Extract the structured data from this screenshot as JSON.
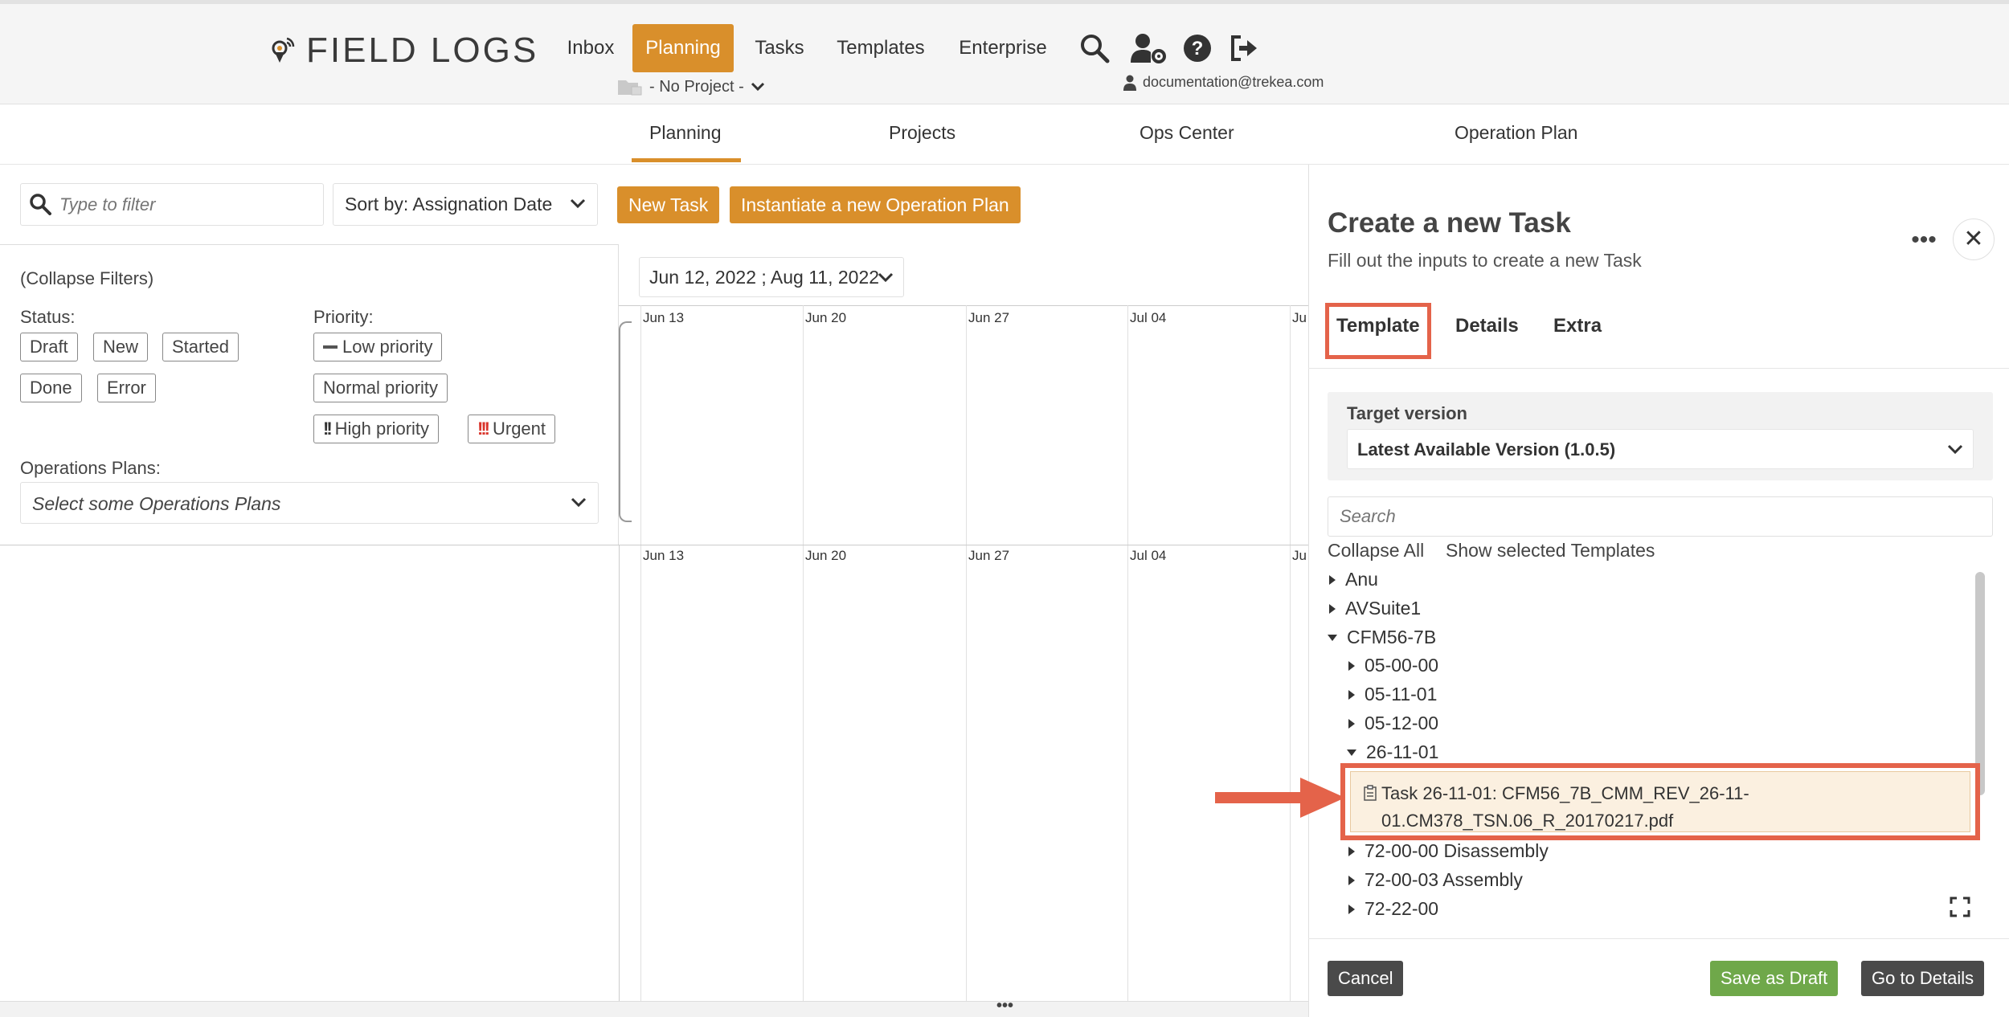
{
  "brand": {
    "name": "FIELD LOGS"
  },
  "topnav": {
    "items": [
      {
        "label": "Inbox"
      },
      {
        "label": "Planning"
      },
      {
        "label": "Tasks"
      },
      {
        "label": "Templates"
      },
      {
        "label": "Enterprise"
      }
    ],
    "project": "- No Project -",
    "user_email": "documentation@trekea.com"
  },
  "subnav": {
    "tabs": [
      {
        "label": "Planning"
      },
      {
        "label": "Projects"
      },
      {
        "label": "Ops Center"
      },
      {
        "label": "Operation Plan"
      }
    ]
  },
  "toolbar": {
    "filter_placeholder": "Type to filter",
    "sort_label": "Sort by: Assignation Date",
    "new_task": "New Task",
    "instantiate": "Instantiate a new Operation Plan"
  },
  "filters": {
    "collapse": "(Collapse Filters)",
    "status_label": "Status:",
    "status": [
      "Draft",
      "New",
      "Started",
      "Done",
      "Error"
    ],
    "priority_label": "Priority:",
    "priority": [
      "Low priority",
      "Normal priority",
      "High priority",
      "Urgent"
    ],
    "opplans_label": "Operations Plans:",
    "opplans_placeholder": "Select some Operations Plans"
  },
  "timeline": {
    "date_range": "Jun 12, 2022 ; Aug 11, 2022",
    "ticks": [
      "Jun 13",
      "Jun 20",
      "Jun 27",
      "Jul 04",
      "Ju"
    ]
  },
  "drawer": {
    "title": "Create a new Task",
    "subtitle": "Fill out the inputs to create a new Task",
    "tabs": [
      "Template",
      "Details",
      "Extra"
    ],
    "target_label": "Target version",
    "target_value": "Latest Available Version (1.0.5)",
    "search_placeholder": "Search",
    "collapse_all": "Collapse All",
    "show_selected": "Show selected Templates",
    "tree": [
      "Anu",
      "AVSuite1",
      "CFM56-7B",
      "05-00-00",
      "05-11-01",
      "05-12-00",
      "26-11-01",
      "72-00-00 Disassembly",
      "72-00-03 Assembly",
      "72-22-00"
    ],
    "selected_task_line1": "Task 26-11-01: CFM56_7B_CMM_REV_26-11-",
    "selected_task_line2": "01.CM378_TSN.06_R_20170217.pdf",
    "cancel": "Cancel",
    "save_draft": "Save as Draft",
    "go_details": "Go to Details"
  },
  "colors": {
    "accent": "#d98f2b",
    "highlight": "#e4634a",
    "success": "#6fa84a"
  }
}
